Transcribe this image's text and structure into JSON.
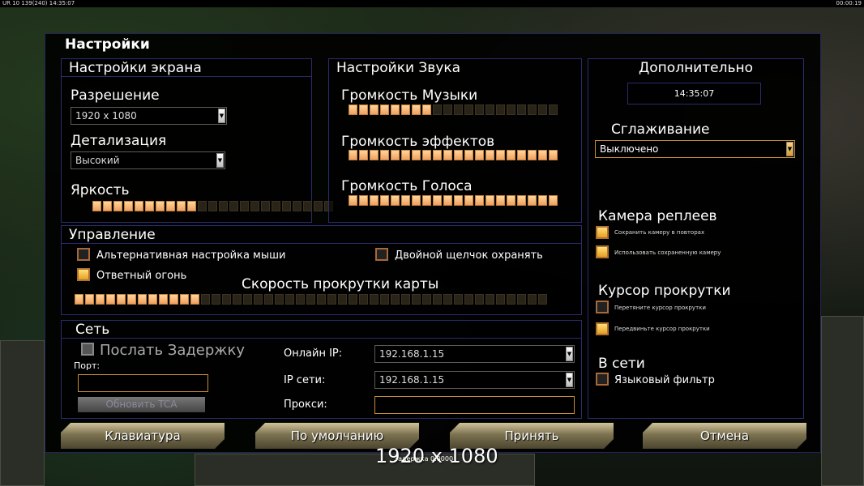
{
  "top_bar": {
    "left": "UR 10 139(240) 14:35:07",
    "right": "00:00:19"
  },
  "dialog": {
    "title": "Настройки"
  },
  "screen": {
    "header": "Настройки экрана",
    "resolution_label": "Разрешение",
    "resolution_value": "1920 x 1080",
    "detail_label": "Детализация",
    "detail_value": "Высокий",
    "brightness_label": "Яркость",
    "brightness_level": 10,
    "brightness_segments": 23
  },
  "sound": {
    "header": "Настройки Звука",
    "music_label": "Громкость Музыки",
    "music_level": 8,
    "effects_label": "Громкость эффектов",
    "effects_level": 20,
    "voice_label": "Громкость Голоса",
    "voice_level": 20,
    "segments": 20
  },
  "extra": {
    "header": "Дополнительно",
    "time": "14:35:07",
    "aa_label": "Сглаживание",
    "aa_value": "Выключено",
    "replay_camera_label": "Камера реплеев",
    "replay_save": "Сохранить камеру в повторах",
    "replay_use": "Использовать сохраненную камеру",
    "scroll_cursor_label": "Курсор прокрутки",
    "scroll_drag": "Перетяните курсор прокрутки",
    "scroll_move": "Передвиньте курсор прокрутки",
    "online_label": "В сети",
    "language_filter": "Языковый фильтр"
  },
  "control": {
    "header": "Управление",
    "alt_mouse": "Альтернативная настройка мыши",
    "double_click": "Двойной щелчок охранять",
    "return_fire": "Ответный огонь",
    "scroll_speed_label": "Скорость прокрутки карты",
    "scroll_level": 12,
    "scroll_segments": 45
  },
  "network": {
    "header": "Сеть",
    "send_delay": "Послать Задержку",
    "port_label": "Порт:",
    "update_tca": "Обновить TCA",
    "online_ip_label": "Онлайн IP:",
    "online_ip": "192.168.1.15",
    "lan_ip_label": "IP сети:",
    "lan_ip": "192.168.1.15",
    "proxy_label": "Прокси:"
  },
  "buttons": {
    "keyboard": "Клавиатура",
    "defaults": "По умолчанию",
    "accept": "Принять",
    "cancel": "Отмена"
  },
  "overlay": {
    "resolution_caption": "1920 x 1080",
    "sub_caption": "Задержка 0.0000"
  },
  "colors": {
    "accent": "#c58d32",
    "border": "#2a2c6e",
    "slider_on": "#f5b56f"
  }
}
